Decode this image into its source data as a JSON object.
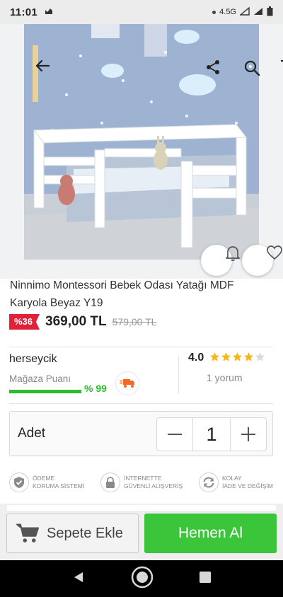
{
  "status_bar": {
    "time": "11:01",
    "network": "4.5G"
  },
  "product": {
    "title": "Ninnimo Montessori Bebek Odası Yatağı MDF Karyola Beyaz Y19",
    "discount": "%36",
    "price": "369,00 TL",
    "old_price": "579,00 TL"
  },
  "seller": {
    "name": "herseycik",
    "score_label": "Mağaza Puanı",
    "score_value": "% 99",
    "score_fraction": 0.99
  },
  "rating": {
    "value": "4.0",
    "stars": 4,
    "max_stars": 5,
    "reviews": "1 yorum"
  },
  "quantity": {
    "label": "Adet",
    "value": "1",
    "minus": "—",
    "plus": "+"
  },
  "badges": [
    {
      "icon": "shield-check-icon",
      "line1": "ÖDEME",
      "line2": "KORUMA SİSTEMİ"
    },
    {
      "icon": "lock-icon",
      "line1": "İNTERNETTE",
      "line2": "GÜVENLİ ALIŞVERİŞ"
    },
    {
      "icon": "refresh-icon",
      "line1": "KOLAY",
      "line2": "İADE VE DEĞİŞİM"
    }
  ],
  "actions": {
    "add_to_cart": "Sepete Ekle",
    "buy_now": "Hemen Al"
  },
  "colors": {
    "accent_green": "#3ac53a",
    "discount_red": "#e3203a",
    "star": "#f5b81c"
  }
}
